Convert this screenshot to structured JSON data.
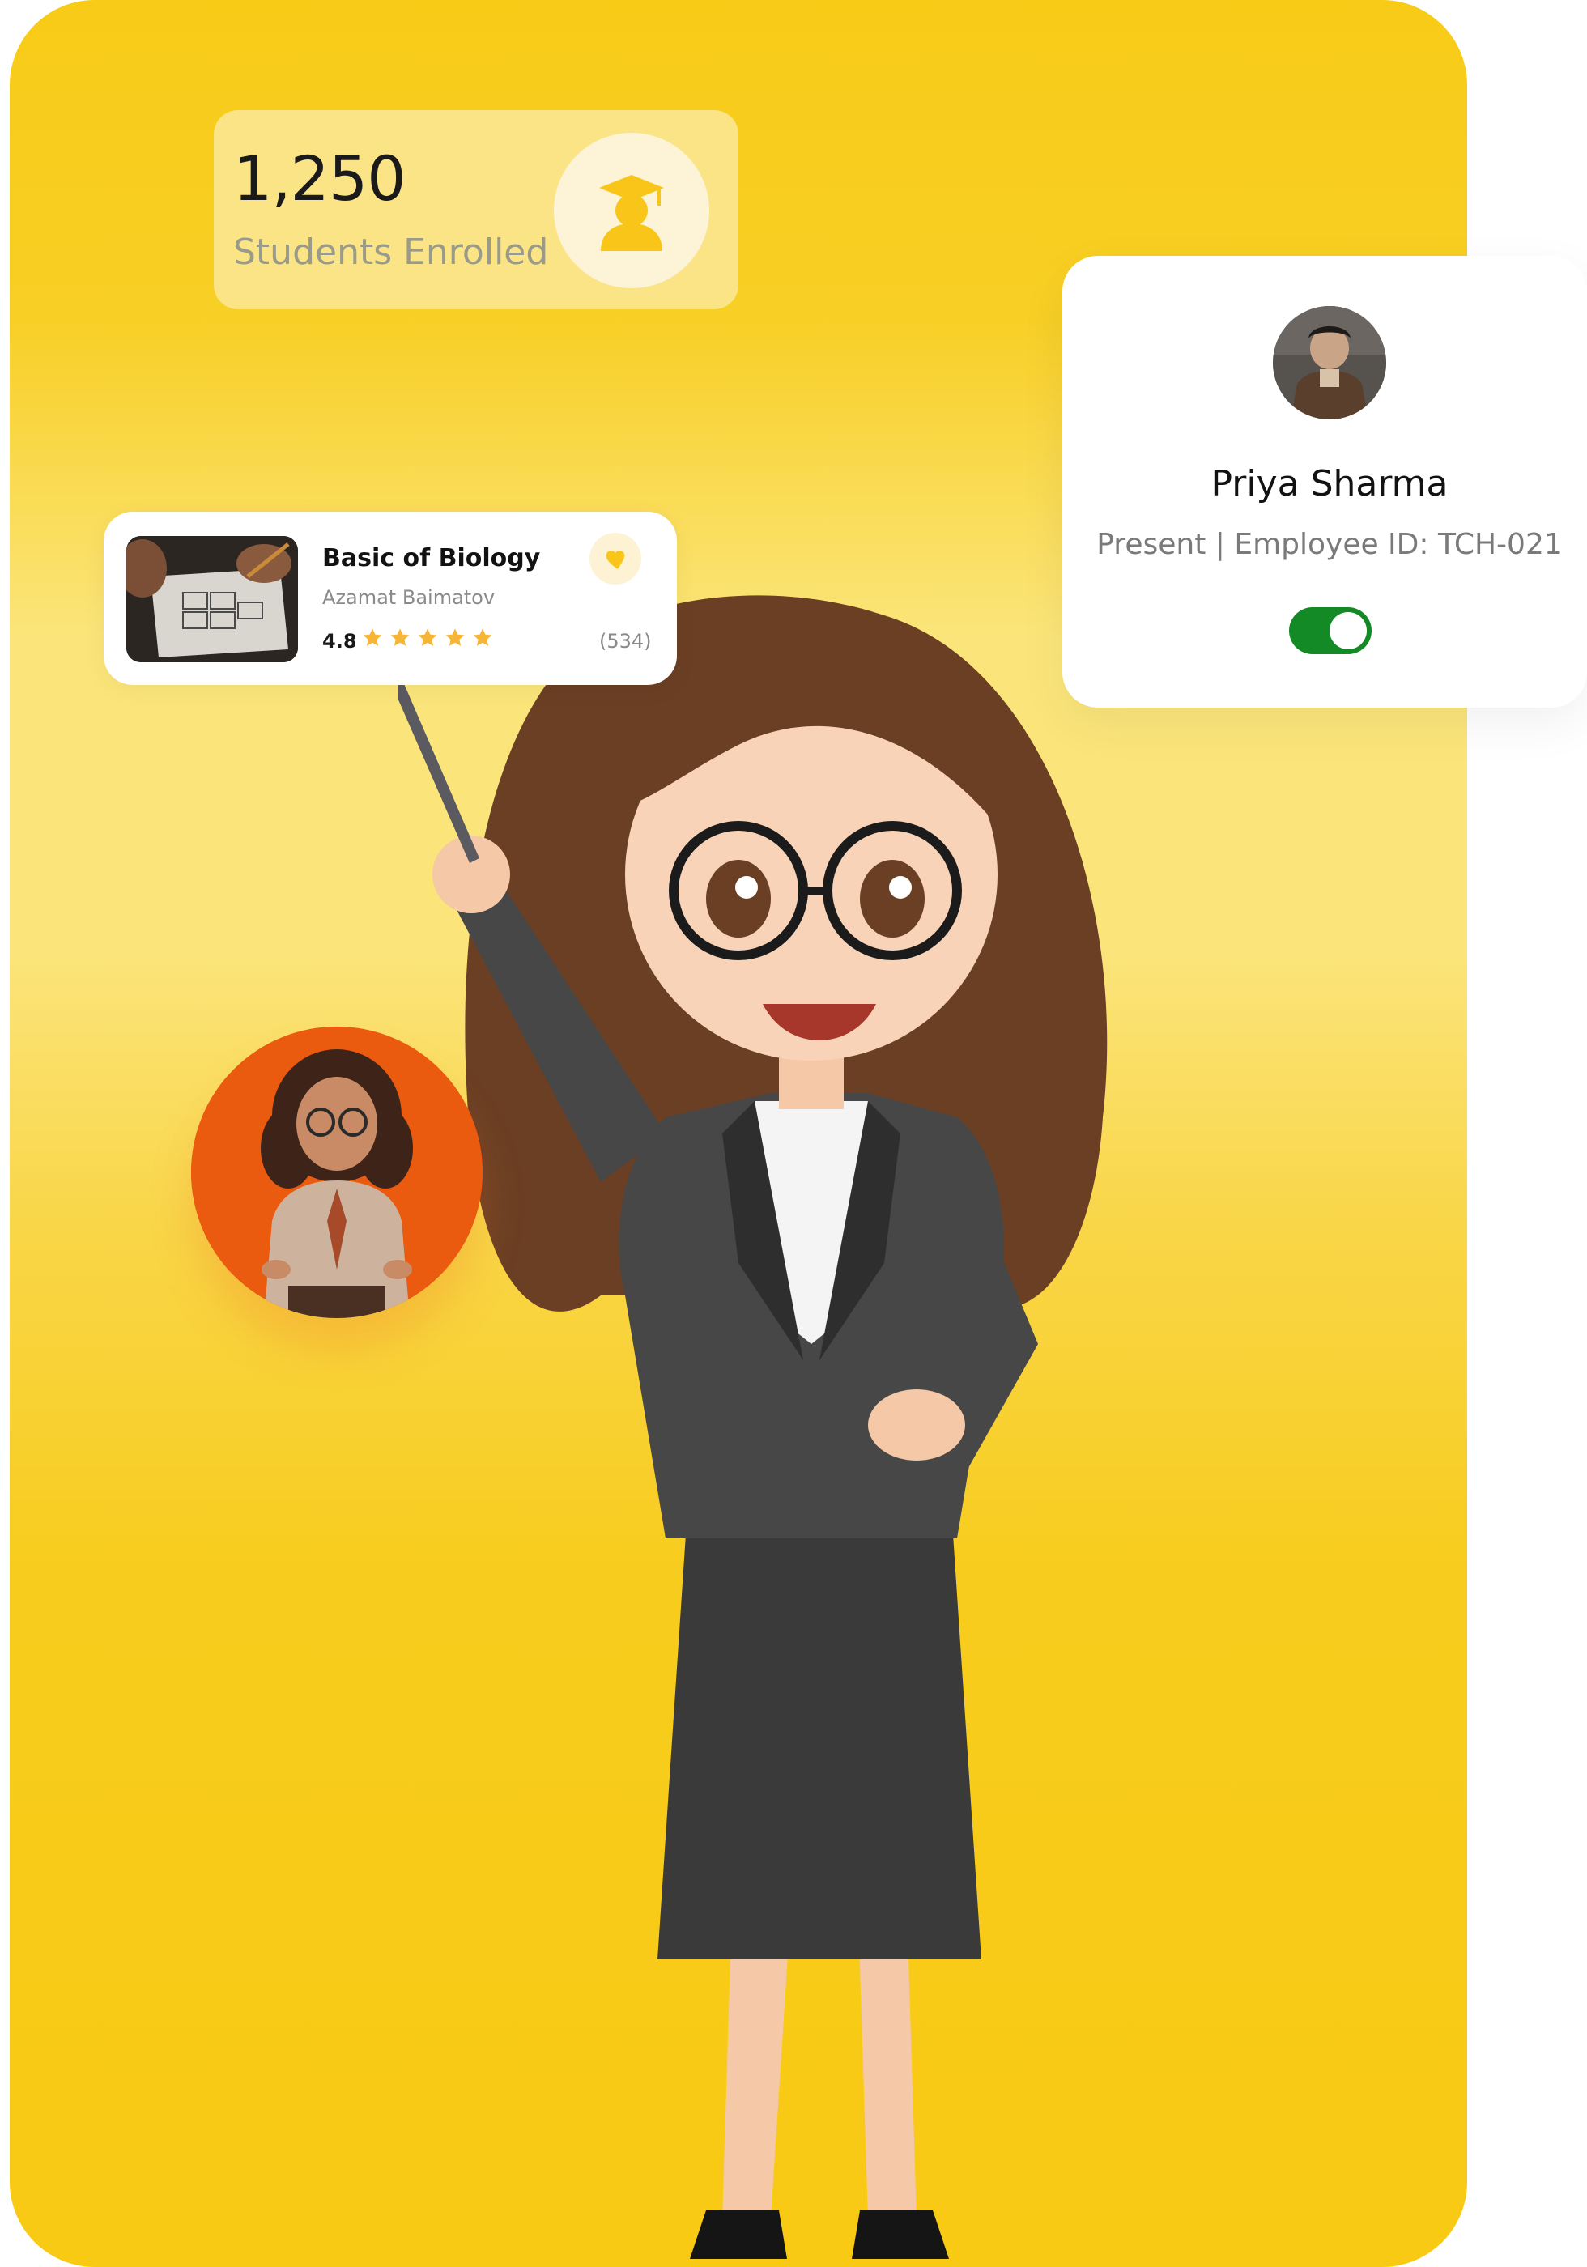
{
  "stats": {
    "number": "1,250",
    "label": "Students Enrolled",
    "icon": "graduate-icon"
  },
  "course": {
    "title": "Basic of Biology",
    "author": "Azamat Baimatov",
    "rating": "4.8",
    "stars": 5,
    "reviews": "(534)",
    "favorite_icon": "heart-icon"
  },
  "employee": {
    "name": "Priya Sharma",
    "meta": "Present | Employee ID: TCH-021",
    "toggle_on": true
  },
  "colors": {
    "accent_yellow": "#f8cb17",
    "toggle_green": "#138a25",
    "avatar_orange": "#ea5a0f",
    "star_color": "#f6b534"
  }
}
